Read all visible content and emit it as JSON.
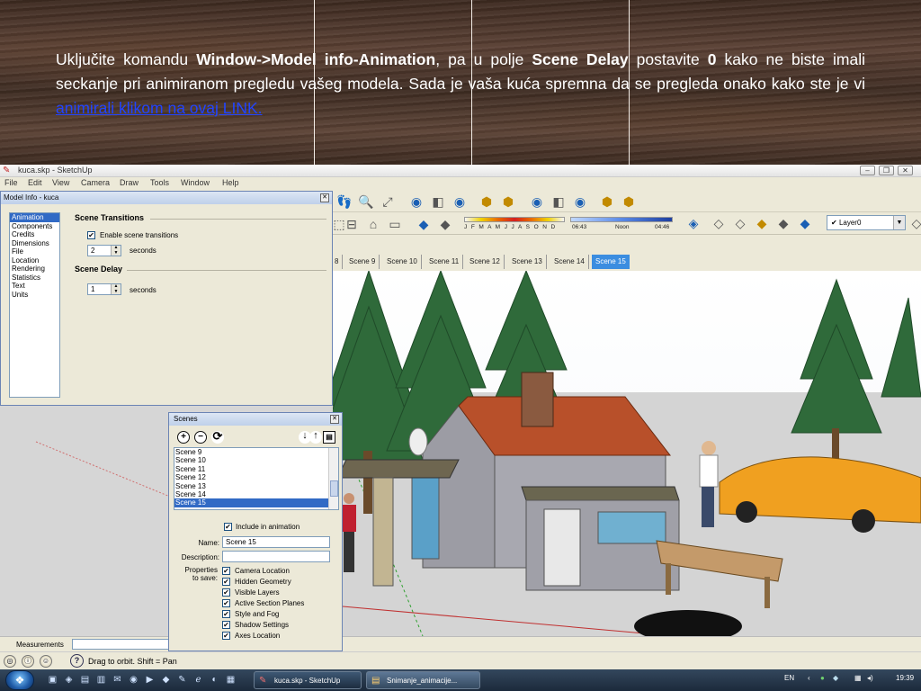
{
  "slide": {
    "text_1": "Uključite komandu ",
    "bold_1": "Window->Model info-Animation",
    "text_2": ", pa u polje ",
    "bold_2": "Scene Delay",
    "text_3": " postavite ",
    "bold_3": "0",
    "text_4": " kako ne biste imali seckanje pri animiranom pregledu vašeg modela. Sada je vaša kuća spremna da se pregleda onako kako ste je vi ",
    "link": "animirali klikom na ovaj LINK."
  },
  "window": {
    "title": "kuca.skp - SketchUp",
    "menu": [
      "File",
      "Edit",
      "View",
      "Camera",
      "Draw",
      "Tools",
      "Window",
      "Help"
    ]
  },
  "shadow": {
    "months": "J F M A M J J A S O N D",
    "time_start": "06:43",
    "time_mid": "Noon",
    "time_end": "04:46"
  },
  "layer": {
    "current": "Layer0"
  },
  "scene_tabs": [
    "8",
    "Scene 9",
    "Scene 10",
    "Scene 11",
    "Scene 12",
    "Scene 13",
    "Scene 14",
    "Scene 15"
  ],
  "scene_tabs_active": "Scene 15",
  "model_info": {
    "title": "Model Info - kuca",
    "categories": [
      "Animation",
      "Components",
      "Credits",
      "Dimensions",
      "File",
      "Location",
      "Rendering",
      "Statistics",
      "Text",
      "Units"
    ],
    "selected": "Animation",
    "transitions_heading": "Scene Transitions",
    "enable_label": "Enable scene transitions",
    "enable_checked": true,
    "transition_value": "2",
    "seconds_1": "seconds",
    "delay_heading": "Scene Delay",
    "delay_value": "1",
    "seconds_2": "seconds"
  },
  "scenes": {
    "title": "Scenes",
    "items": [
      "Scene 9",
      "Scene 10",
      "Scene 11",
      "Scene 12",
      "Scene 13",
      "Scene 14",
      "Scene 15"
    ],
    "selected": "Scene 15",
    "include_label": "Include in animation",
    "name_label": "Name:",
    "name_value": "Scene 15",
    "description_label": "Description:",
    "description_value": "",
    "properties_label_1": "Properties",
    "properties_label_2": "to save:",
    "properties": [
      "Camera Location",
      "Hidden Geometry",
      "Visible Layers",
      "Active Section Planes",
      "Style and Fog",
      "Shadow Settings",
      "Axes Location"
    ]
  },
  "measurements": {
    "label": "Measurements"
  },
  "status": {
    "message": "Drag to orbit.  Shift = Pan"
  },
  "taskbar": {
    "tasks": [
      "kuca.skp - SketchUp",
      "Snimanje_animacije..."
    ],
    "lang": "EN",
    "clock": "19:39"
  }
}
